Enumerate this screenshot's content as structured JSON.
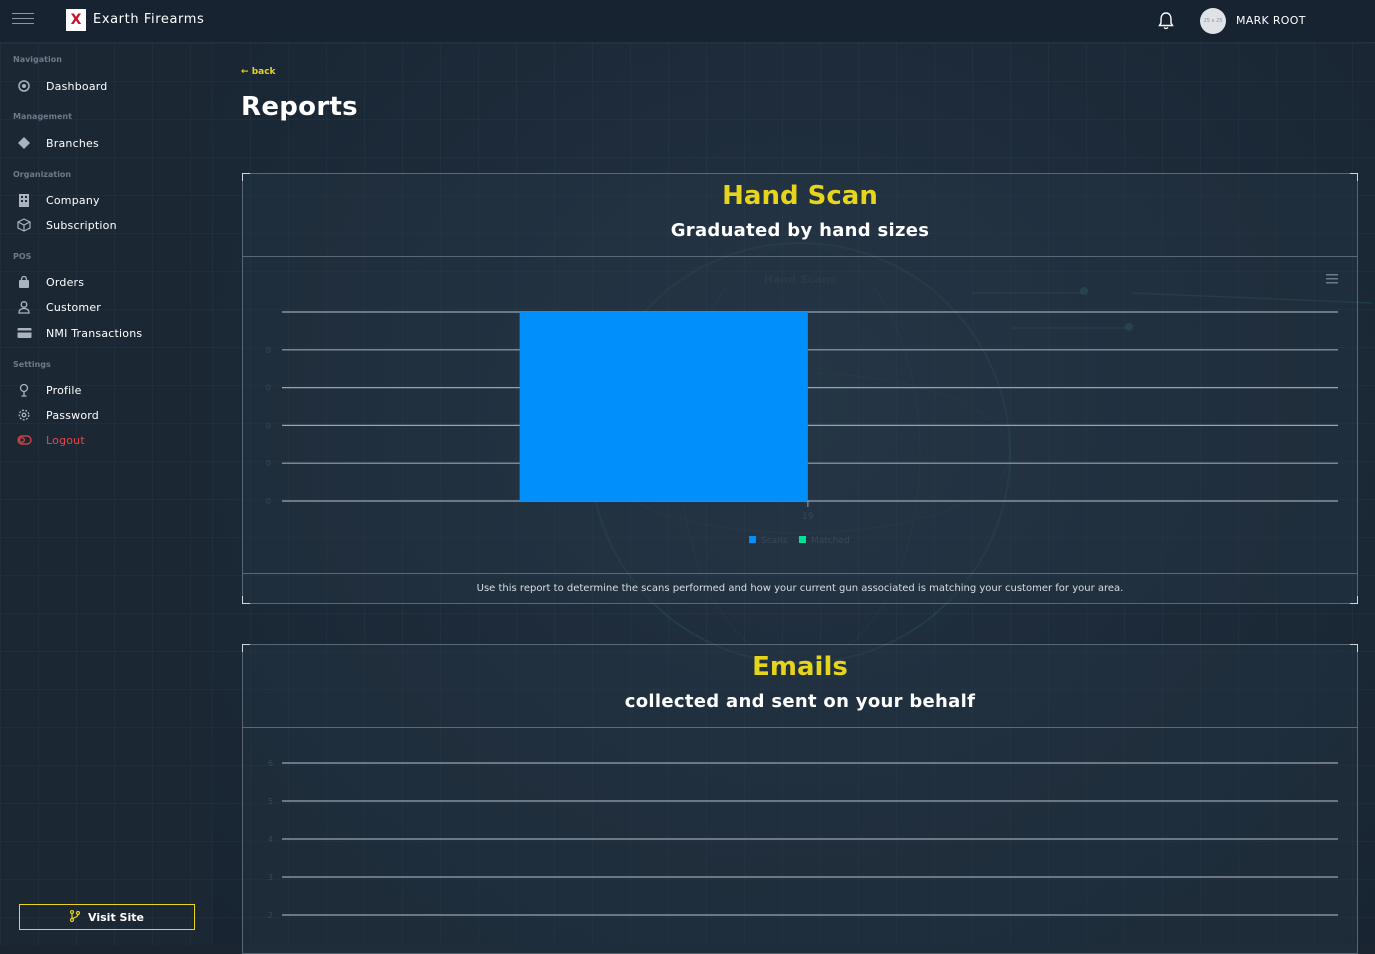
{
  "header": {
    "brand": "Exarth Firearms",
    "logo_letter": "X",
    "user_name": "MARK ROOT",
    "avatar_text": "25 x 25"
  },
  "sidebar": {
    "sections": [
      {
        "label": "Navigation",
        "items": [
          {
            "label": "Dashboard",
            "icon": "dashboard-icon"
          }
        ]
      },
      {
        "label": "Management",
        "items": [
          {
            "label": "Branches",
            "icon": "branches-icon"
          }
        ]
      },
      {
        "label": "Organization",
        "items": [
          {
            "label": "Company",
            "icon": "building-icon"
          },
          {
            "label": "Subscription",
            "icon": "box-icon"
          }
        ]
      },
      {
        "label": "POS",
        "items": [
          {
            "label": "Orders",
            "icon": "bag-icon"
          },
          {
            "label": "Customer",
            "icon": "user-icon"
          },
          {
            "label": "NMI Transactions",
            "icon": "card-icon"
          }
        ]
      },
      {
        "label": "Settings",
        "items": [
          {
            "label": "Profile",
            "icon": "profile-icon"
          },
          {
            "label": "Password",
            "icon": "gear-icon"
          },
          {
            "label": "Logout",
            "icon": "toggle-icon"
          }
        ]
      }
    ],
    "visit_site": "Visit Site"
  },
  "page": {
    "back": "back",
    "title": "Reports"
  },
  "hand_scan": {
    "title": "Hand Scan",
    "subtitle": "Graduated by hand sizes",
    "footer": "Use this report to determine the scans performed and how your current gun associated is matching your customer for your area."
  },
  "emails": {
    "title": "Emails",
    "subtitle": "collected and sent on your behalf"
  },
  "colors": {
    "accent": "#e7d51b",
    "scans": "#008ffb",
    "matched": "#00e396",
    "logout": "#e5484d"
  },
  "chart_data": [
    {
      "type": "bar",
      "title": "Hand Scans",
      "categories": [
        "19"
      ],
      "series": [
        {
          "name": "Scans",
          "values": [
            5
          ]
        },
        {
          "name": "Matched",
          "values": [
            0
          ]
        }
      ],
      "y_ticks": [
        "0",
        "0",
        "0",
        "0",
        "0"
      ],
      "ylim": [
        0,
        5
      ],
      "legend": "bottom-center",
      "grid": true,
      "menu_icon": "hamburger-menu-icon"
    },
    {
      "type": "line",
      "y_ticks": [
        "6",
        "5",
        "4",
        "3",
        "2"
      ],
      "ylim": [
        2,
        6
      ],
      "grid": true
    }
  ]
}
